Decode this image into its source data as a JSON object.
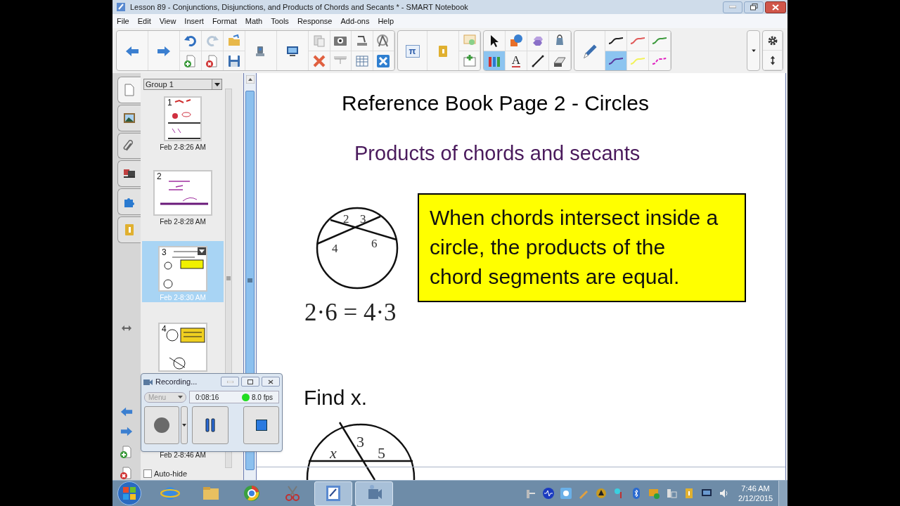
{
  "window": {
    "title": "Lesson 89 - Conjunctions, Disjunctions, and Products of Chords and Secants * - SMART Notebook"
  },
  "menu": [
    "File",
    "Edit",
    "View",
    "Insert",
    "Format",
    "Math",
    "Tools",
    "Response",
    "Add-ons",
    "Help"
  ],
  "math_button": "π",
  "tools": [
    {
      "selected": false
    },
    {
      "selected": false
    },
    {
      "selected": false
    },
    {
      "selected": false
    },
    {
      "selected": true
    },
    {
      "selected": false,
      "label": "A"
    },
    {
      "selected": false
    },
    {
      "selected": false
    }
  ],
  "pen_styles": [
    {
      "color": "#222222",
      "selected": false
    },
    {
      "color": "#e05a5a",
      "selected": false
    },
    {
      "color": "#3d9a3d",
      "selected": false
    },
    {
      "color": "#5a3aa0",
      "selected": true
    },
    {
      "color": "#f2f25a",
      "selected": false
    },
    {
      "color": "#e020c0",
      "selected": false
    }
  ],
  "side_tabs": [
    {
      "selected": true
    },
    {
      "selected": false
    },
    {
      "selected": false
    },
    {
      "selected": false
    },
    {
      "selected": false
    },
    {
      "selected": false
    }
  ],
  "sorter": {
    "group": "Group 1",
    "pages": [
      {
        "number": "1",
        "date": "Feb 2-8:26 AM",
        "selected": false
      },
      {
        "number": "2",
        "date": "Feb 2-8:28 AM",
        "selected": false
      },
      {
        "number": "3",
        "date": "Feb 2-8:30 AM",
        "selected": true
      },
      {
        "number": "4",
        "date": "Feb 2-8:46 AM",
        "selected": false
      }
    ],
    "auto_hide": {
      "label": "Auto-hide",
      "checked": false
    }
  },
  "recorder": {
    "title": "Recording...",
    "menu": "Menu",
    "time": "0:08:16",
    "fps": "8.0 fps"
  },
  "page": {
    "title": "Reference Book Page 2 - Circles",
    "subtitle": "Products of chords and secants",
    "diagram_labels": [
      "2",
      "3",
      "4",
      "6"
    ],
    "equation": "2·6 = 4·3",
    "callout": "When chords intersect inside a circle, the products of the chord segments are equal.",
    "prompt": "Find x.",
    "problem_labels": [
      "x",
      "3",
      "5"
    ]
  },
  "taskbar": {
    "apps": [
      {
        "active": false
      },
      {
        "active": false
      },
      {
        "active": false
      },
      {
        "active": false
      },
      {
        "active": true
      },
      {
        "active": true
      }
    ],
    "time": "7:46 AM",
    "date": "2/12/2015"
  }
}
